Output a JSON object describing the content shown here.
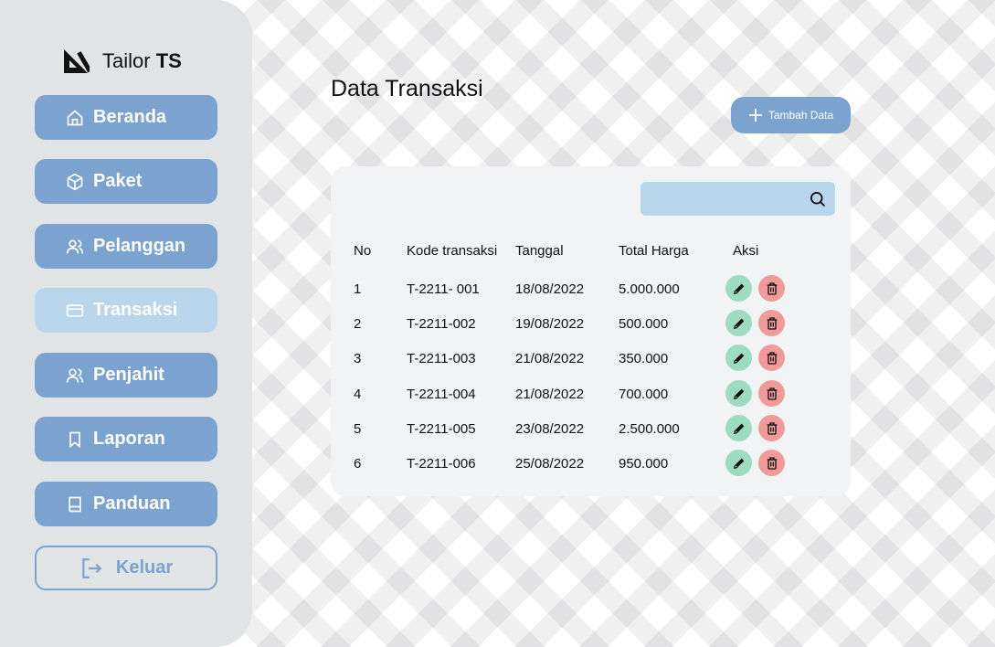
{
  "app": {
    "brand_prefix": "Tailor ",
    "brand_bold": "TS",
    "logo_icon": "ruler-triangle-icon"
  },
  "sidebar": {
    "items": [
      {
        "label": "Beranda",
        "icon": "home-icon",
        "active": false
      },
      {
        "label": "Paket",
        "icon": "package-icon",
        "active": false
      },
      {
        "label": "Pelanggan",
        "icon": "users-icon",
        "active": false
      },
      {
        "label": "Transaksi",
        "icon": "card-icon",
        "active": true
      },
      {
        "label": "Penjahit",
        "icon": "users-icon",
        "active": false
      },
      {
        "label": "Laporan",
        "icon": "bookmark-icon",
        "active": false
      },
      {
        "label": "Panduan",
        "icon": "book-icon",
        "active": false
      }
    ],
    "logout_label": "Keluar"
  },
  "main": {
    "title": "Data Transaksi",
    "add_label": "Tambah Data",
    "search": {
      "value": "",
      "placeholder": ""
    },
    "table": {
      "headers": [
        "No",
        "Kode transaksi",
        "Tanggal",
        "Total Harga",
        "Aksi"
      ],
      "rows": [
        [
          "1",
          "T-2211- 001",
          "18/08/2022",
          "5.000.000"
        ],
        [
          "2",
          "T-2211-002",
          "19/08/2022",
          "500.000"
        ],
        [
          "3",
          "T-2211-003",
          "21/08/2022",
          "350.000"
        ],
        [
          "4",
          "T-2211-004",
          "21/08/2022",
          "700.000"
        ],
        [
          "5",
          "T-2211-005",
          "23/08/2022",
          "2.500.000"
        ],
        [
          "6",
          "T-2211-006",
          "25/08/2022",
          "950.000"
        ]
      ]
    }
  },
  "colors": {
    "nav": "#7ca2d0",
    "nav_active": "#b9d6ec",
    "sidebar_bg": "#e0e4e5",
    "edit": "#9edcc1",
    "delete": "#f19a9a",
    "search_bg": "#b8d7ec"
  }
}
